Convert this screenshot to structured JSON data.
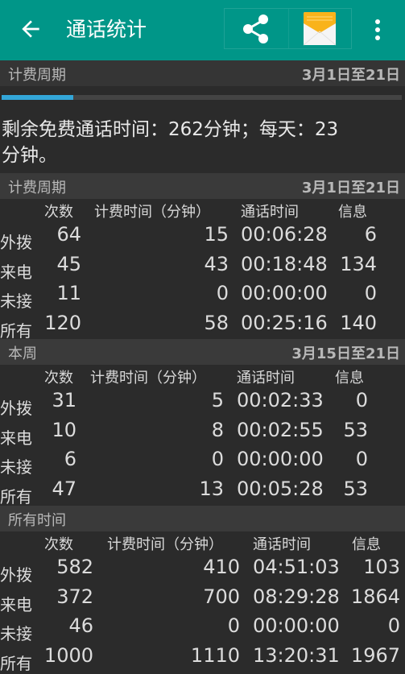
{
  "appbar": {
    "title": "通话统计",
    "back_icon": "arrow-back-icon",
    "share_icon": "share-icon",
    "mail_icon": "mail-icon",
    "more_icon": "more-vert-icon",
    "color": "#009688"
  },
  "billing_top": {
    "label": "计费周期",
    "range": "3月1日至21日",
    "progress_percent": 18,
    "progress_color": "#33a6d8"
  },
  "summary": "剩余免费通话时间：262分钟；每天：23分钟。",
  "columns": [
    "次数",
    "计费时间（分钟）",
    "通话时间",
    "信息"
  ],
  "sections": [
    {
      "label": "计费周期",
      "range": "3月1日至21日",
      "rows": [
        {
          "label": "外拨",
          "count": "64",
          "billed": "15",
          "duration": "00:06:28",
          "messages": "6"
        },
        {
          "label": "来电",
          "count": "45",
          "billed": "43",
          "duration": "00:18:48",
          "messages": "134"
        },
        {
          "label": "未接",
          "count": "11",
          "billed": "0",
          "duration": "00:00:00",
          "messages": "0"
        },
        {
          "label": "所有",
          "count": "120",
          "billed": "58",
          "duration": "00:25:16",
          "messages": "140"
        }
      ]
    },
    {
      "label": "本周",
      "range": "3月15日至21日",
      "rows": [
        {
          "label": "外拨",
          "count": "31",
          "billed": "5",
          "duration": "00:02:33",
          "messages": "0"
        },
        {
          "label": "来电",
          "count": "10",
          "billed": "8",
          "duration": "00:02:55",
          "messages": "53"
        },
        {
          "label": "未接",
          "count": "6",
          "billed": "0",
          "duration": "00:00:00",
          "messages": "0"
        },
        {
          "label": "所有",
          "count": "47",
          "billed": "13",
          "duration": "00:05:28",
          "messages": "53"
        }
      ]
    },
    {
      "label": "所有时间",
      "range": "",
      "rows": [
        {
          "label": "外拨",
          "count": "582",
          "billed": "410",
          "duration": "04:51:03",
          "messages": "103"
        },
        {
          "label": "来电",
          "count": "372",
          "billed": "700",
          "duration": "08:29:28",
          "messages": "1864"
        },
        {
          "label": "未接",
          "count": "46",
          "billed": "0",
          "duration": "00:00:00",
          "messages": "0"
        },
        {
          "label": "所有",
          "count": "1000",
          "billed": "1110",
          "duration": "13:20:31",
          "messages": "1967"
        }
      ]
    }
  ]
}
